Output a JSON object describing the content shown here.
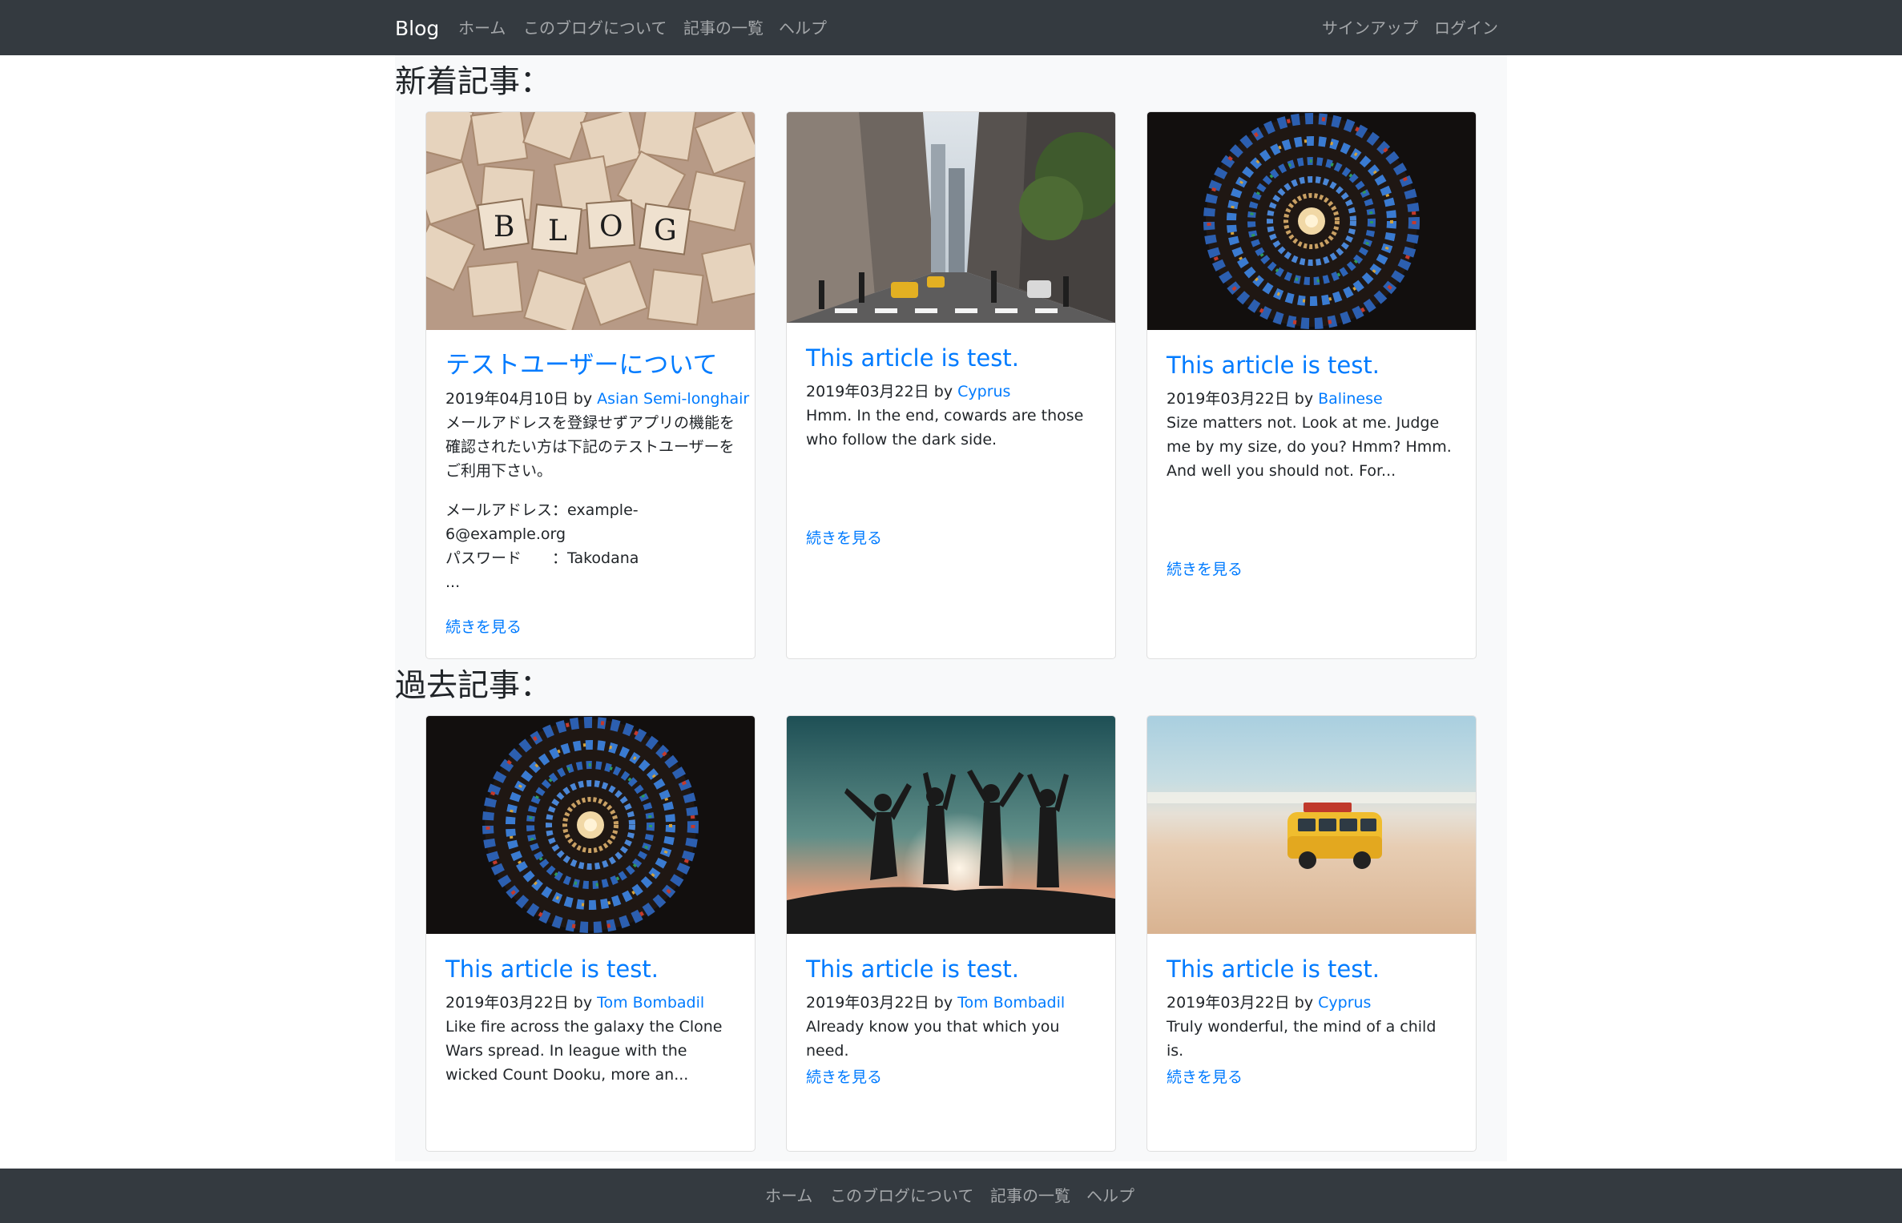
{
  "navbar": {
    "brand": "Blog",
    "links": [
      "ホーム",
      "このブログについて",
      "記事の一覧",
      "ヘルプ"
    ],
    "right_links": [
      "サインアップ",
      "ログイン"
    ]
  },
  "sections": {
    "recent_heading": "新着記事：",
    "past_heading": "過去記事："
  },
  "read_more": "続きを見る",
  "by": "by",
  "recent": [
    {
      "image": "scrabble-tiles-blog-photo",
      "title": "テストユーザーについて",
      "date": "2019年04月10日",
      "author": "Asian Semi-longhair",
      "excerpt_p1": "メールアドレスを登録せずアプリの機能を確認されたい方は下記のテストユーザーをご利用下さい。",
      "excerpt_line1": "メールアドレス：example-",
      "excerpt_line2": "6@example.org",
      "excerpt_line3": "パスワード　　：Takodana",
      "excerpt_line4": "..."
    },
    {
      "image": "city-street-photo",
      "title": "This article is test.",
      "date": "2019年03月22日",
      "author": "Cyprus",
      "excerpt": "Hmm. In the end, cowards are those who follow the dark side."
    },
    {
      "image": "stained-glass-spiral-photo",
      "title": "This article is test.",
      "date": "2019年03月22日",
      "author": "Balinese",
      "excerpt": "Size matters not. Look at me. Judge me by my size, do you? Hmm? Hmm. And well you should not. For..."
    }
  ],
  "past": [
    {
      "image": "stained-glass-spiral-photo",
      "title": "This article is test.",
      "date": "2019年03月22日",
      "author": "Tom Bombadil",
      "excerpt": "Like fire across the galaxy the Clone Wars spread. In league with the wicked Count Dooku, more an..."
    },
    {
      "image": "silhouettes-sunset-photo",
      "title": "This article is test.",
      "date": "2019年03月22日",
      "author": "Tom Bombadil",
      "excerpt": "Already know you that which you need."
    },
    {
      "image": "toy-van-beach-photo",
      "title": "This article is test.",
      "date": "2019年03月22日",
      "author": "Cyprus",
      "excerpt": "Truly wonderful, the mind of a child is."
    }
  ],
  "footer": {
    "links": [
      "ホーム",
      "このブログについて",
      "記事の一覧",
      "ヘルプ"
    ]
  },
  "colors": {
    "navbar_bg": "#343a40",
    "link": "#007bff",
    "container_bg": "#f8f9fa"
  }
}
